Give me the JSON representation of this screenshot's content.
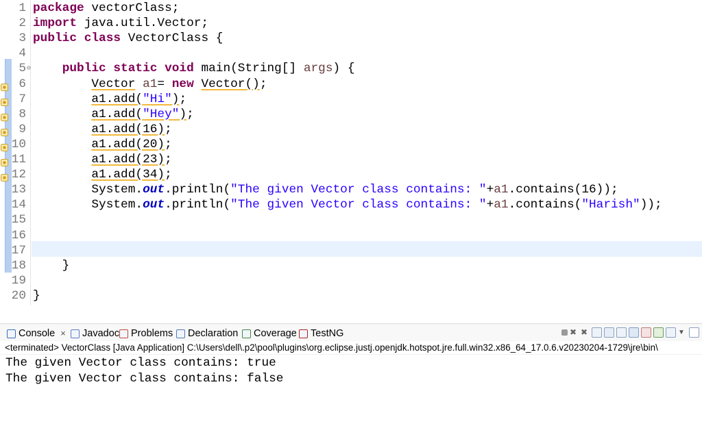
{
  "editor": {
    "lines": [
      {
        "n": "1",
        "segs": [
          [
            "kw",
            "package"
          ],
          [
            "",
            " vectorClass;"
          ]
        ]
      },
      {
        "n": "2",
        "segs": [
          [
            "kw",
            "import"
          ],
          [
            "",
            " java.util.Vector;"
          ]
        ]
      },
      {
        "n": "3",
        "segs": [
          [
            "kw",
            "public"
          ],
          [
            "",
            " "
          ],
          [
            "kw",
            "class"
          ],
          [
            "",
            " VectorClass {"
          ]
        ]
      },
      {
        "n": "4",
        "segs": []
      },
      {
        "n": "5",
        "segs": [
          [
            "",
            "    "
          ],
          [
            "kw",
            "public"
          ],
          [
            "",
            " "
          ],
          [
            "kw",
            "static"
          ],
          [
            "",
            " "
          ],
          [
            "kw",
            "void"
          ],
          [
            "",
            " main(String[] "
          ],
          [
            "var",
            "args"
          ],
          [
            "",
            ") {"
          ]
        ]
      },
      {
        "n": "6",
        "segs": [
          [
            "",
            "        "
          ],
          [
            "wu",
            "Vector"
          ],
          [
            "",
            " "
          ],
          [
            "var",
            "a1"
          ],
          [
            "",
            "= "
          ],
          [
            "kw",
            "new"
          ],
          [
            "",
            " "
          ],
          [
            "wu",
            "Vector()"
          ],
          [
            "",
            ";"
          ]
        ]
      },
      {
        "n": "7",
        "segs": [
          [
            "",
            "        "
          ],
          [
            "wu",
            "a1.add("
          ],
          [
            "wstr",
            "\"Hi\""
          ],
          [
            "wu",
            ")"
          ],
          [
            "",
            ";"
          ]
        ]
      },
      {
        "n": "8",
        "segs": [
          [
            "",
            "        "
          ],
          [
            "wu",
            "a1.add("
          ],
          [
            "wstr",
            "\"Hey\""
          ],
          [
            "wu",
            ")"
          ],
          [
            "",
            ";"
          ]
        ]
      },
      {
        "n": "9",
        "segs": [
          [
            "",
            "        "
          ],
          [
            "wu",
            "a1.add(16)"
          ],
          [
            "",
            ";"
          ]
        ]
      },
      {
        "n": "10",
        "segs": [
          [
            "",
            "        "
          ],
          [
            "wu",
            "a1.add(20)"
          ],
          [
            "",
            ";"
          ]
        ]
      },
      {
        "n": "11",
        "segs": [
          [
            "",
            "        "
          ],
          [
            "wu",
            "a1.add(23)"
          ],
          [
            "",
            ";"
          ]
        ]
      },
      {
        "n": "12",
        "segs": [
          [
            "",
            "        "
          ],
          [
            "wu",
            "a1.add(34)"
          ],
          [
            "",
            ";"
          ]
        ]
      },
      {
        "n": "13",
        "segs": [
          [
            "",
            "        System."
          ],
          [
            "fld",
            "out"
          ],
          [
            "",
            ".println("
          ],
          [
            "str",
            "\"The given Vector class contains: \""
          ],
          [
            "",
            "+"
          ],
          [
            "var",
            "a1"
          ],
          [
            "",
            ".contains(16));"
          ]
        ]
      },
      {
        "n": "14",
        "segs": [
          [
            "",
            "        System."
          ],
          [
            "fld",
            "out"
          ],
          [
            "",
            ".println("
          ],
          [
            "str",
            "\"The given Vector class contains: \""
          ],
          [
            "",
            "+"
          ],
          [
            "var",
            "a1"
          ],
          [
            "",
            ".contains("
          ],
          [
            "str",
            "\"Harish\""
          ],
          [
            "",
            "));"
          ]
        ]
      },
      {
        "n": "15",
        "segs": []
      },
      {
        "n": "16",
        "segs": []
      },
      {
        "n": "17",
        "segs": []
      },
      {
        "n": "18",
        "segs": [
          [
            "",
            "    }"
          ]
        ]
      },
      {
        "n": "19",
        "segs": []
      },
      {
        "n": "20",
        "segs": [
          [
            "",
            "}"
          ]
        ]
      }
    ],
    "warning_lines": [
      "6",
      "7",
      "8",
      "9",
      "10",
      "11",
      "12"
    ],
    "fold_marker": "⊖",
    "current_line": "17"
  },
  "views": {
    "tabs": [
      {
        "label": "Console",
        "icon": "console-icon",
        "color": "#3a6fb5",
        "closable": true
      },
      {
        "label": "Javadoc",
        "icon": "javadoc-icon",
        "color": "#5a7cc4"
      },
      {
        "label": "Problems",
        "icon": "problems-icon",
        "color": "#c04a3a"
      },
      {
        "label": "Declaration",
        "icon": "declaration-icon",
        "color": "#4f7ab8"
      },
      {
        "label": "Coverage",
        "icon": "coverage-icon",
        "color": "#3d8a3d"
      },
      {
        "label": "TestNG",
        "icon": "testng-icon",
        "color": "#b02020"
      }
    ],
    "close_glyph": "×"
  },
  "console": {
    "header": "<terminated> VectorClass [Java Application] C:\\Users\\dell\\.p2\\pool\\plugins\\org.eclipse.justj.openjdk.hotspot.jre.full.win32.x86_64_17.0.6.v20230204-1729\\jre\\bin\\",
    "output": [
      "The given Vector class contains: true",
      "The given Vector class contains: false"
    ]
  },
  "colors": {
    "keyword": "#7f0055",
    "string": "#2a00ff",
    "local": "#6a3e3e",
    "field": "#0000c0",
    "current_line": "#e8f2fe"
  }
}
